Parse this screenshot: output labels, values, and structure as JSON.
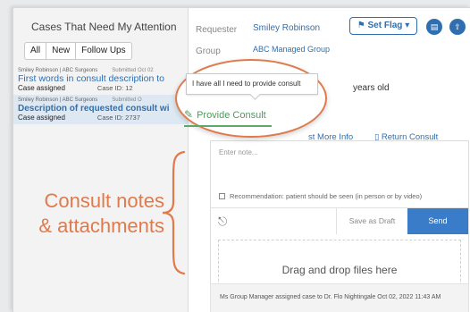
{
  "left_panel": {
    "title": "Cases That Need My Attention",
    "filters": [
      "All",
      "New",
      "Follow Ups"
    ],
    "cases": [
      {
        "meta": "Smiley Robinson | ABC Surgeons",
        "submitted": "Submitted Oct 02",
        "title": "First words in consult description to",
        "status": "Case assigned",
        "case_id": "Case ID: 12"
      },
      {
        "meta": "Smiley Robinson | ABC Surgeons",
        "submitted": "Submitted O",
        "title": "Description of requested consult wi",
        "status": "Case assigned",
        "case_id": "Case ID: 2737"
      }
    ]
  },
  "case_header": {
    "requester_label": "Requester",
    "requester_value": "Smiley Robinson",
    "group_label": "Group",
    "group_value": "ABC Managed Group",
    "set_flag_label": "Set Flag",
    "age_text": "years old",
    "more_info_label": "st More Info",
    "return_consult_label": "Return Consult"
  },
  "tooltip": {
    "text": "I have all I need to provide consult"
  },
  "provide_consult": {
    "label": "Provide Consult"
  },
  "consult_form": {
    "note_placeholder": "Enter note...",
    "recommendation_label": "Recommendation: patient should be seen (in person or by video)",
    "save_draft_label": "Save as Draft",
    "send_label": "Send",
    "drop_text": "Drag and drop files here"
  },
  "activity": {
    "text": "Ms Group Manager assigned case to Dr. Flo Nightingale  Oct 02, 2022  11:43 AM"
  },
  "annotation": {
    "line1": "Consult notes",
    "line2": "& attachments",
    "color": "#e07a4a"
  },
  "colors": {
    "accent": "#2f6fb0",
    "send": "#3b7cc8",
    "provide_green": "#4f9a5e"
  }
}
